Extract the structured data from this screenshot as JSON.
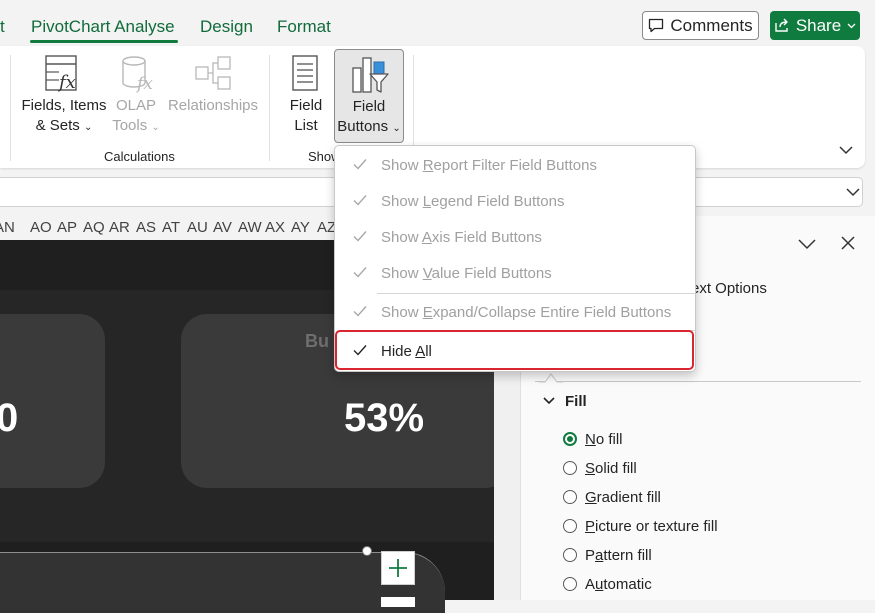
{
  "tabs": [
    {
      "label": "t"
    },
    {
      "label": "PivotChart Analyse",
      "active": true
    },
    {
      "label": "Design"
    },
    {
      "label": "Format"
    }
  ],
  "header": {
    "comments_label": "Comments",
    "share_label": "Share"
  },
  "ribbon": {
    "fields_items_sets": {
      "line1": "Fields, Items",
      "line2": "& Sets"
    },
    "olap_tools": {
      "line1": "OLAP",
      "line2": "Tools"
    },
    "relationships": {
      "label": "Relationships"
    },
    "field_list": {
      "line1": "Field",
      "line2": "List"
    },
    "field_buttons": {
      "line1": "Field",
      "line2": "Buttons"
    },
    "group_calculations": "Calculations",
    "group_show": "Show"
  },
  "columns": [
    "AN",
    "AO",
    "AP",
    "AQ",
    "AR",
    "AS",
    "AT",
    "AU",
    "AV",
    "AW",
    "AX",
    "AY",
    "AZ"
  ],
  "dashboard": {
    "kpi_left": "0",
    "kpi_right": "53%",
    "card_title_right": "Bu"
  },
  "menu": {
    "items": [
      {
        "pre": "Show ",
        "key": "R",
        "post": "eport Filter Field Buttons",
        "checked": true,
        "enabled": false
      },
      {
        "pre": "Show ",
        "key": "L",
        "post": "egend Field Buttons",
        "checked": true,
        "enabled": false
      },
      {
        "pre": "Show ",
        "key": "A",
        "post": "xis Field Buttons",
        "checked": true,
        "enabled": false
      },
      {
        "pre": "Show ",
        "key": "V",
        "post": "alue Field Buttons",
        "checked": true,
        "enabled": false
      },
      {
        "pre": "Show ",
        "key": "E",
        "post": "xpand/Collapse Entire Field Buttons",
        "checked": true,
        "enabled": false
      },
      {
        "pre": "Hide ",
        "key": "A",
        "post": "ll",
        "checked": true,
        "enabled": true
      }
    ]
  },
  "pane": {
    "tab_text": "ext Options",
    "section_title": "Fill",
    "options": [
      {
        "key": "N",
        "rest": "o fill",
        "selected": true
      },
      {
        "key": "S",
        "rest": "olid fill",
        "selected": false
      },
      {
        "key": "G",
        "rest": "radient fill",
        "selected": false
      },
      {
        "key": "P",
        "rest": "icture or texture fill",
        "selected": false
      },
      {
        "pre": "P",
        "key": "a",
        "rest": "ttern fill",
        "selected": false
      },
      {
        "pre": "A",
        "key": "u",
        "rest": "tomatic",
        "selected": false
      }
    ]
  },
  "colors": {
    "accent_green": "#117a3f",
    "highlight_red": "#d9252f",
    "sheet_dark": "#1f1f1f",
    "card_gray": "#3a3a3a"
  }
}
